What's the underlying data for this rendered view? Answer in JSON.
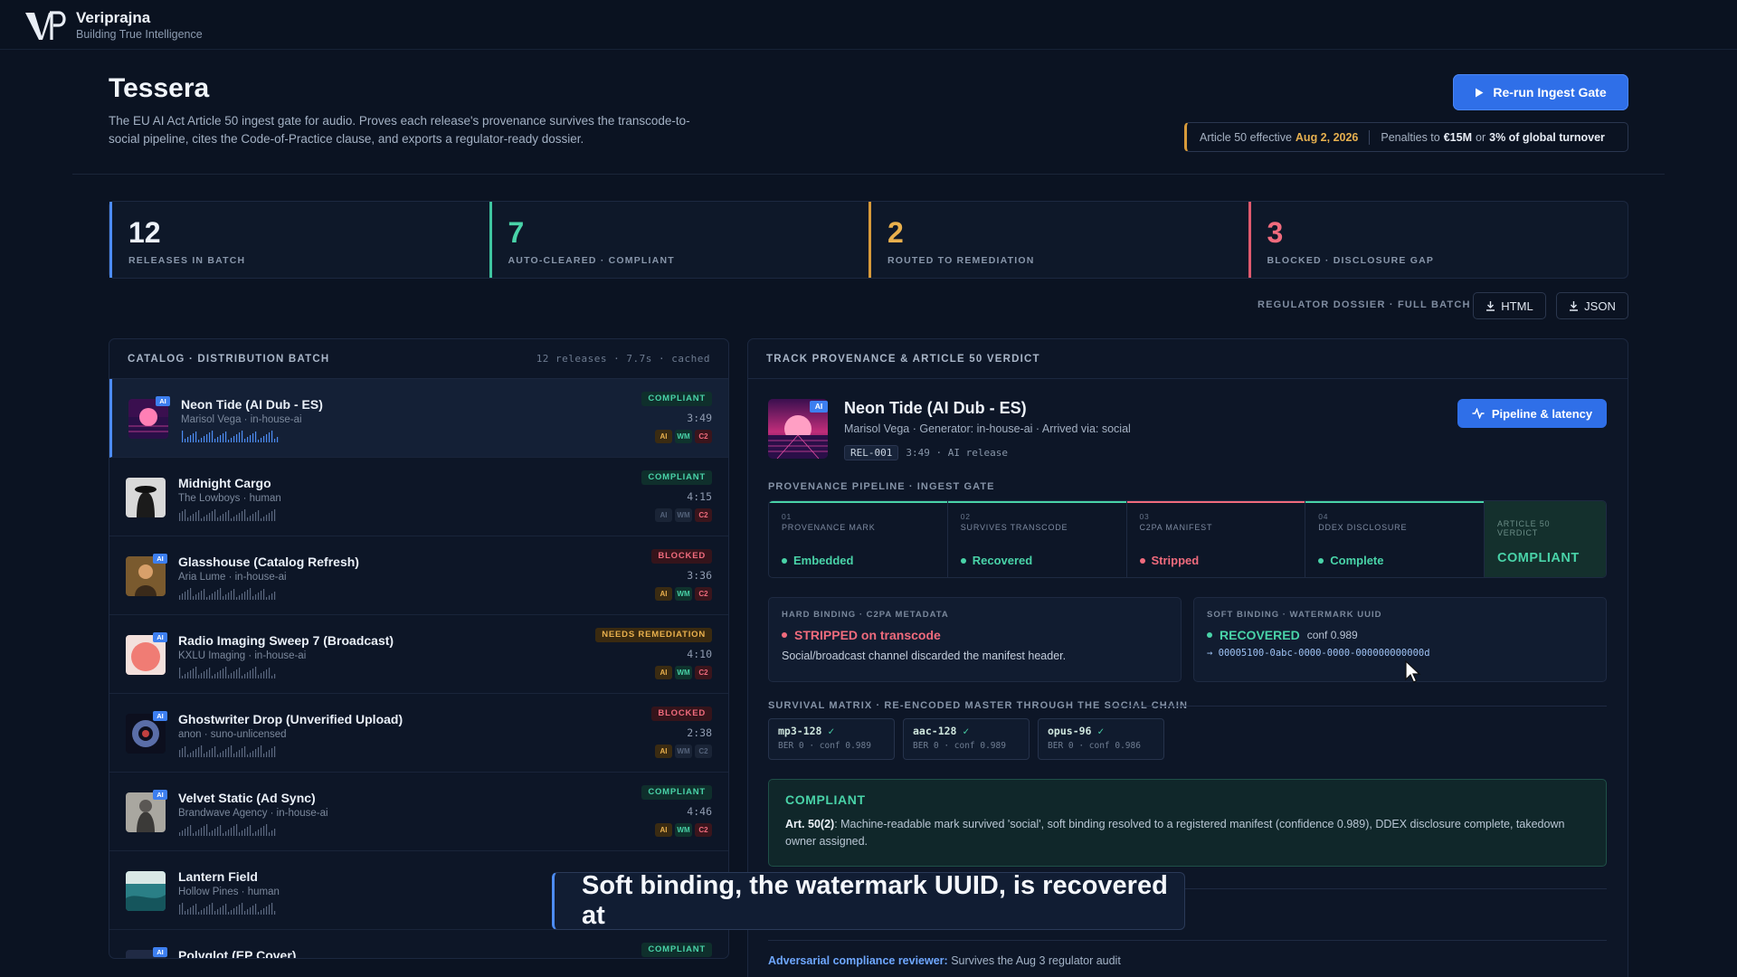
{
  "brand": {
    "name": "Veriprajna",
    "tagline": "Building True Intelligence"
  },
  "header": {
    "title": "Tessera",
    "description": "The EU AI Act Article 50 ingest gate for audio. Proves each release's provenance survives the transcode-to-social pipeline, cites the Code-of-Practice clause, and exports a regulator-ready dossier.",
    "primary_button": "Re-run Ingest Gate",
    "deadline": {
      "prefix": "Article 50 effective",
      "date": "Aug 2, 2026",
      "penalty_prefix": "Penalties to",
      "amount": "€15M",
      "or": "or",
      "turnover": "3% of global turnover"
    }
  },
  "stats": [
    {
      "value": "12",
      "label": "RELEASES IN BATCH",
      "color": "#4d8cf4",
      "num_color": "#eef3fa"
    },
    {
      "value": "7",
      "label": "AUTO-CLEARED · COMPLIANT",
      "color": "#3fc5a0",
      "num_color": "#49d3a8"
    },
    {
      "value": "2",
      "label": "ROUTED TO REMEDIATION",
      "color": "#d79a3a",
      "num_color": "#e9b04d"
    },
    {
      "value": "3",
      "label": "BLOCKED · DISCLOSURE GAP",
      "color": "#e05a6e",
      "num_color": "#f06b7d"
    }
  ],
  "dossier": {
    "label": "REGULATOR DOSSIER · FULL BATCH",
    "html": "HTML",
    "json": "JSON"
  },
  "catalog": {
    "title": "CATALOG · DISTRIBUTION BATCH",
    "meta": "12 releases · 7.7s · cached",
    "tracks": [
      {
        "title": "Neon Tide (AI Dub - ES)",
        "sub": "Marisol Vega · in-house-ai",
        "status": "COMPLIANT",
        "status_kind": "compliant",
        "duration": "3:49",
        "ai": true,
        "chips": [
          "ai",
          "wm",
          "c2"
        ],
        "art": "neon"
      },
      {
        "title": "Midnight Cargo",
        "sub": "The Lowboys · human",
        "status": "COMPLIANT",
        "status_kind": "compliant",
        "duration": "4:15",
        "ai": false,
        "chips": [
          "off",
          "off",
          "c2"
        ],
        "art": "cargo"
      },
      {
        "title": "Glasshouse (Catalog Refresh)",
        "sub": "Aria Lume · in-house-ai",
        "status": "BLOCKED",
        "status_kind": "blocked",
        "duration": "3:36",
        "ai": true,
        "chips": [
          "ai",
          "wm",
          "c2"
        ],
        "art": "glass"
      },
      {
        "title": "Radio Imaging Sweep 7 (Broadcast)",
        "sub": "KXLU Imaging · in-house-ai",
        "status": "NEEDS REMEDIATION",
        "status_kind": "remed",
        "duration": "4:10",
        "ai": true,
        "chips": [
          "ai",
          "wm",
          "c2"
        ],
        "art": "radio"
      },
      {
        "title": "Ghostwriter Drop (Unverified Upload)",
        "sub": "anon · suno-unlicensed",
        "status": "BLOCKED",
        "status_kind": "blocked",
        "duration": "2:38",
        "ai": true,
        "chips": [
          "ai",
          "off",
          "off"
        ],
        "art": "ghost"
      },
      {
        "title": "Velvet Static (Ad Sync)",
        "sub": "Brandwave Agency · in-house-ai",
        "status": "COMPLIANT",
        "status_kind": "compliant",
        "duration": "4:46",
        "ai": true,
        "chips": [
          "ai",
          "wm",
          "c2"
        ],
        "art": "velvet"
      },
      {
        "title": "Lantern Field",
        "sub": "Hollow Pines · human",
        "status": "",
        "status_kind": "compliant",
        "duration": "",
        "ai": false,
        "chips": [],
        "art": "lantern"
      },
      {
        "title": "Polyglot (EP Cover)",
        "sub": "",
        "status": "COMPLIANT",
        "status_kind": "compliant",
        "duration": "",
        "ai": true,
        "chips": [],
        "art": "poly"
      }
    ]
  },
  "detail": {
    "panel_title": "TRACK PROVENANCE & ARTICLE 50 VERDICT",
    "title": "Neon Tide (AI Dub - ES)",
    "sub": "Marisol Vega · Generator: in-house-ai · Arrived via: social",
    "rel": "REL-001",
    "tag_rest": "3:49 · AI release",
    "pipeline_button": "Pipeline & latency",
    "pipeline_label": "PROVENANCE PIPELINE · INGEST GATE",
    "stages": [
      {
        "num": "01",
        "name": "PROVENANCE MARK",
        "status": "Embedded",
        "color": "#49d3a8"
      },
      {
        "num": "02",
        "name": "SURVIVES TRANSCODE",
        "status": "Recovered",
        "color": "#49d3a8"
      },
      {
        "num": "03",
        "name": "C2PA MANIFEST",
        "status": "Stripped",
        "color": "#f06b7d"
      },
      {
        "num": "04",
        "name": "DDEX DISCLOSURE",
        "status": "Complete",
        "color": "#49d3a8"
      }
    ],
    "verdict_cell": {
      "label": "ARTICLE 50 VERDICT",
      "value": "COMPLIANT"
    },
    "hard": {
      "head": "HARD BINDING · C2PA METADATA",
      "status": "STRIPPED on transcode",
      "desc": "Social/broadcast channel discarded the manifest header."
    },
    "soft": {
      "head": "SOFT BINDING · WATERMARK UUID",
      "status": "RECOVERED",
      "conf": "conf 0.989",
      "uuid": "→ 00005100-0abc-0000-0000-000000000000d"
    },
    "matrix_label": "SURVIVAL MATRIX · RE-ENCODED MASTER THROUGH THE SOCIAL CHAIN",
    "codecs": [
      {
        "name": "mp3-128",
        "meta": "BER 0 · conf 0.989"
      },
      {
        "name": "aac-128",
        "meta": "BER 0 · conf 0.989"
      },
      {
        "name": "opus-96",
        "meta": "BER 0 · conf 0.986"
      }
    ],
    "verdict": {
      "head": "COMPLIANT",
      "clause": "Art. 50(2)",
      "text": ": Machine-readable mark survived 'social', soft binding resolved to a registered manifest (confidence 0.989), DDEX disclosure complete, takedown owner assigned."
    },
    "reviewer_label": "Adversarial compliance reviewer:",
    "reviewer_text": " Survives the Aug 3 regulator audit"
  },
  "caption": "Soft binding, the watermark UUID, is recovered at",
  "colors": {
    "accent": "#2f6fe8",
    "compliant": "#49d3a8",
    "blocked": "#f06b7d",
    "remediation": "#e9b04d"
  }
}
